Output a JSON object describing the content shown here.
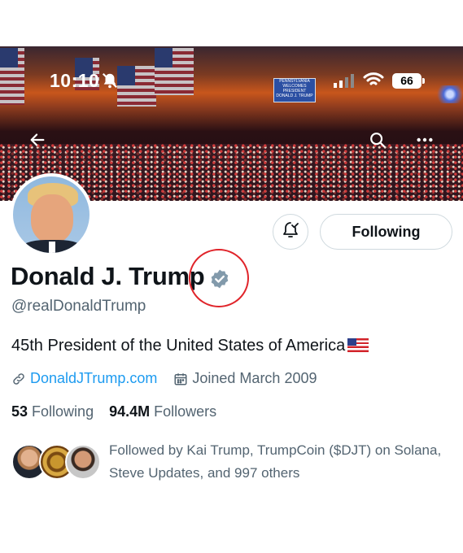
{
  "status_bar": {
    "time": "10:10",
    "battery": "66",
    "icons": [
      "bell-slash-icon",
      "signal-bars-icon",
      "wifi-icon",
      "battery-icon"
    ]
  },
  "banner": {
    "sign_text": "PENNSYLVANIA WELCOMES PRESIDENT DONALD J. TRUMP",
    "nav_icons": [
      "back-arrow-icon",
      "search-icon",
      "more-icon"
    ]
  },
  "actions": {
    "notify_icon": "bell-check-icon",
    "following_label": "Following"
  },
  "profile": {
    "name": "Donald J. Trump",
    "verified_icon": "verified-badge-icon",
    "handle": "@realDonaldTrump",
    "bio": "45th President of the United States of America",
    "bio_emoji": "us-flag-emoji",
    "website": "DonaldJTrump.com",
    "joined": "Joined March 2009",
    "following_count": "53",
    "following_label": "Following",
    "followers_count": "94.4M",
    "followers_label": "Followers",
    "followed_by": "Followed by Kai Trump, TrumpCoin ($DJT) on Solana, Steve Updates, and 997 others"
  },
  "colors": {
    "link": "#1d9bf0",
    "verified": "#829aab",
    "secondary_text": "#536471",
    "annotation": "#e0242a"
  }
}
